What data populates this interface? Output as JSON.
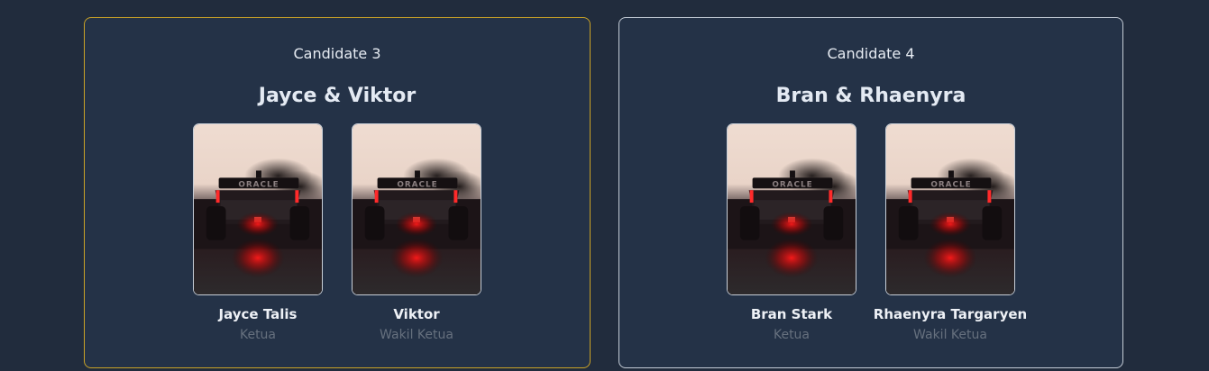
{
  "candidates": [
    {
      "label": "Candidate 3",
      "pair": "Jayce & Viktor",
      "selected": true,
      "members": [
        {
          "name": "Jayce Talis",
          "role": "Ketua",
          "photo": "race-car-rear-photo"
        },
        {
          "name": "Viktor",
          "role": "Wakil Ketua",
          "photo": "race-car-rear-photo"
        }
      ]
    },
    {
      "label": "Candidate 4",
      "pair": "Bran & Rhaenyra",
      "selected": false,
      "members": [
        {
          "name": "Bran Stark",
          "role": "Ketua",
          "photo": "race-car-rear-photo"
        },
        {
          "name": "Rhaenyra Targaryen",
          "role": "Wakil Ketua",
          "photo": "race-car-rear-photo"
        }
      ]
    }
  ],
  "colors": {
    "page_background": "#212c3d",
    "card_background": "#243247",
    "selected_border": "#c9a227",
    "default_border": "#c4ccd6",
    "role_text": "#66707e"
  }
}
